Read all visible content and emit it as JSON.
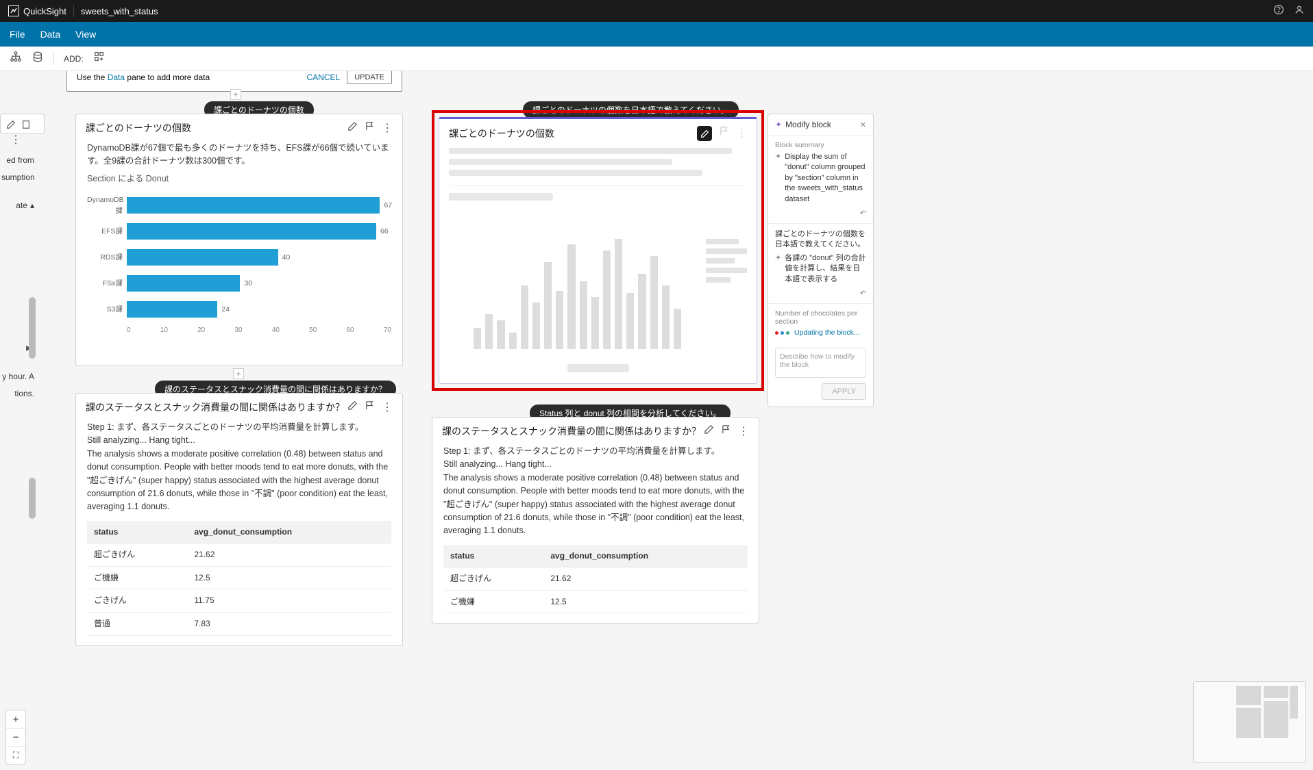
{
  "app": {
    "brand": "QuickSight",
    "doc_title": "sweets_with_status"
  },
  "menus": {
    "file": "File",
    "data": "Data",
    "view": "View"
  },
  "toolbar": {
    "add": "ADD:"
  },
  "data_banner": {
    "pre": "Use the ",
    "link": "Data",
    "post": " pane to add more data",
    "cancel": "CANCEL",
    "update": "UPDATE"
  },
  "left_frag": {
    "row1": "ed from",
    "row2": "sumption",
    "row3": "ate",
    "row4": "y hour. A",
    "row5": "tions."
  },
  "prompts": {
    "p1": "課ごとのドーナツの個数",
    "p2": "課ごとのドーナツの個数を日本語で教えてください。",
    "p3": "課のステータスとスナック消費量の間に関係はありますか？",
    "p4": "Status 列と donut 列の相関を分析してください。"
  },
  "block1": {
    "title": "課ごとのドーナツの個数",
    "summary": "DynamoDB課が67個で最も多くのドーナツを持ち、EFS課が66個で続いています。全9課の合計ドーナツ数は300個です。",
    "chart_title": "Section による Donut"
  },
  "loading": {
    "title": "課ごとのドーナツの個数"
  },
  "modify": {
    "title": "Modify block",
    "summary_label": "Block summary",
    "summary_text": "Display the sum of \"donut\" column grouped by \"section\" column in the sweets_with_status dataset",
    "jp_q": "課ごとのドーナツの個数を日本語で教えてください。",
    "jp_a": "各課の \"donut\" 列の合計値を計算し、結果を日本語で表示する",
    "choc_label": "Number of chocolates per section",
    "updating": "Updating the block...",
    "placeholder": "Describe how to modify the block",
    "apply": "APPLY"
  },
  "block3": {
    "title": "課のステータスとスナック消費量の間に関係はありますか？",
    "step": "Step 1: まず、各ステータスごとのドーナツの平均消費量を計算します。",
    "analyzing": "Still analyzing... Hang tight...",
    "analysis": "The analysis shows a moderate positive correlation (0.48) between status and donut consumption. People with better moods tend to eat more donuts, with the \"超ごきげん\" (super happy) status associated with the highest average donut consumption of 21.6 donuts, while those in \"不調\" (poor condition) eat the least, averaging 1.1 donuts.",
    "col1": "status",
    "col2": "avg_donut_consumption",
    "rows": [
      {
        "s": "超ごきげん",
        "v": "21.62"
      },
      {
        "s": "ご機嫌",
        "v": "12.5"
      },
      {
        "s": "ごきげん",
        "v": "11.75"
      },
      {
        "s": "普通",
        "v": "7.83"
      }
    ]
  },
  "block4": {
    "title": "課のステータスとスナック消費量の間に関係はありますか？",
    "rows": [
      {
        "s": "超ごきげん",
        "v": "21.62"
      },
      {
        "s": "ご機嫌",
        "v": "12.5"
      }
    ]
  },
  "chart_data": {
    "type": "bar",
    "orientation": "horizontal",
    "title": "Section による Donut",
    "xlabel": "",
    "ylabel": "",
    "xlim": [
      0,
      70
    ],
    "ticks": [
      0,
      10,
      20,
      30,
      40,
      50,
      60,
      70
    ],
    "categories": [
      "DynamoDB課",
      "EFS課",
      "RDS課",
      "FSx課",
      "S3課"
    ],
    "values": [
      67,
      66,
      40,
      30,
      24
    ]
  }
}
